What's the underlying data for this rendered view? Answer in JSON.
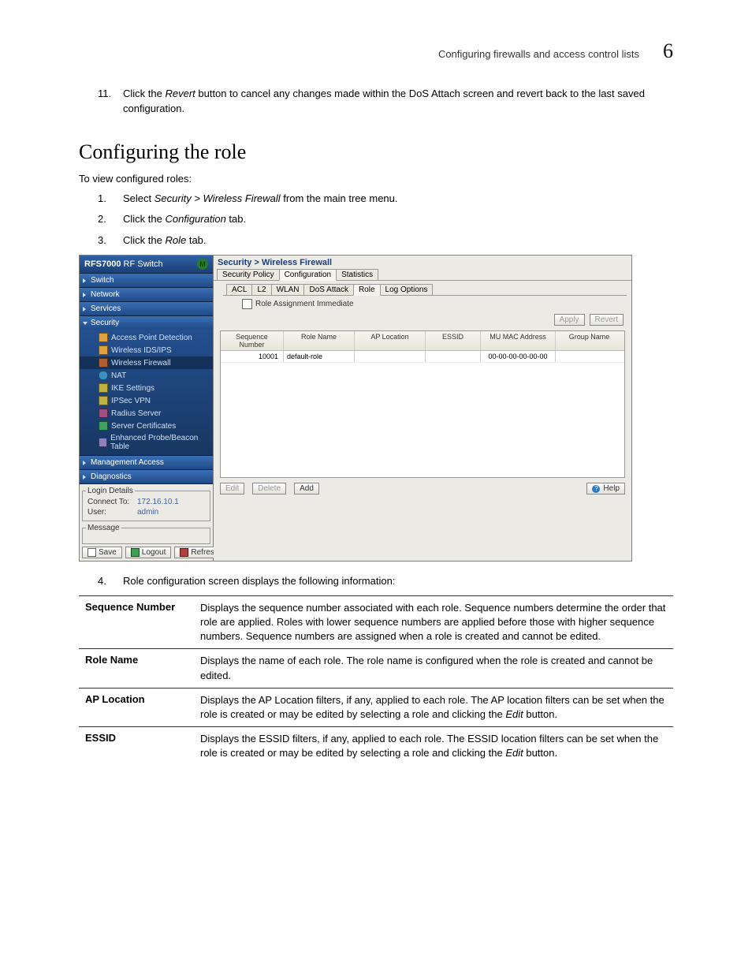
{
  "header": {
    "running": "Configuring firewalls and access control lists",
    "chapter_num": "6"
  },
  "pre_steps": {
    "n11": "11.",
    "t11a": "Click the ",
    "t11b": "Revert",
    "t11c": " button to cancel any changes made within the DoS Attach screen and revert back to the last saved configuration."
  },
  "section_heading": "Configuring the role",
  "intro": "To view configured roles:",
  "steps": {
    "n1": "1.",
    "t1a": "Select ",
    "t1b": "Security > Wireless Firewall",
    "t1c": " from the main tree menu.",
    "n2": "2.",
    "t2a": "Click the ",
    "t2b": "Configuration",
    "t2c": " tab.",
    "n3": "3.",
    "t3a": "Click the ",
    "t3b": "Role",
    "t3c": " tab.",
    "n4": "4.",
    "t4": "Role configuration screen displays the following information:"
  },
  "app": {
    "device_title_bold": "RFS7000",
    "device_title_rest": " RF Switch",
    "nav": {
      "switch": "Switch",
      "network": "Network",
      "services": "Services",
      "security": "Security",
      "apd": "Access Point Detection",
      "ids": "Wireless IDS/IPS",
      "wfw": "Wireless Firewall",
      "nat": "NAT",
      "ike": "IKE Settings",
      "ipsec": "IPSec VPN",
      "radius": "Radius Server",
      "cert": "Server Certificates",
      "probe": "Enhanced Probe/Beacon Table",
      "mgmt": "Management Access",
      "diag": "Diagnostics"
    },
    "login": {
      "legend": "Login Details",
      "connect_lbl": "Connect To:",
      "connect_val": "172.16.10.1",
      "user_lbl": "User:",
      "user_val": "admin"
    },
    "message_legend": "Message",
    "foot": {
      "save": "Save",
      "logout": "Logout",
      "refresh": "Refresh"
    },
    "crumb": "Security > Wireless Firewall",
    "tabs_top": {
      "policy": "Security Policy",
      "config": "Configuration",
      "stats": "Statistics"
    },
    "tabs_sub": {
      "acl": "ACL",
      "l2": "L2",
      "wlan": "WLAN",
      "dos": "DoS Attack",
      "role": "Role",
      "log": "Log Options"
    },
    "check_label": "Role Assignment Immediate",
    "buttons": {
      "apply": "Apply",
      "revert": "Revert",
      "edit": "Edit",
      "delete": "Delete",
      "add": "Add",
      "help": "Help"
    },
    "cols": {
      "seq": "Sequence Number",
      "name": "Role Name",
      "aploc": "AP Location",
      "essid": "ESSID",
      "mac": "MU MAC Address",
      "group": "Group Name"
    },
    "row": {
      "seq": "10001",
      "name": "default-role",
      "aploc": "",
      "essid": "",
      "mac": "00-00-00-00-00-00",
      "group": ""
    }
  },
  "info": {
    "seq_k": "Sequence Number",
    "seq_v": "Displays the sequence number associated with each role. Sequence numbers determine the order that role are applied. Roles with lower sequence numbers are applied before those with higher sequence numbers. Sequence numbers are assigned when a role is created and cannot be edited.",
    "name_k": "Role Name",
    "name_v": "Displays the name of each role. The role name is configured when the role is created and cannot be edited.",
    "aploc_k": "AP Location",
    "aploc_v_a": "Displays the AP Location filters, if any, applied to each role. The AP location filters can be set when the role is created or may be edited by selecting a role and clicking the ",
    "aploc_v_b": "Edit",
    "aploc_v_c": " button.",
    "essid_k": "ESSID",
    "essid_v_a": "Displays the ESSID filters, if any, applied to each role. The ESSID location filters can be set when the role is created or may be edited by selecting a role and clicking the ",
    "essid_v_b": "Edit",
    "essid_v_c": " button."
  }
}
